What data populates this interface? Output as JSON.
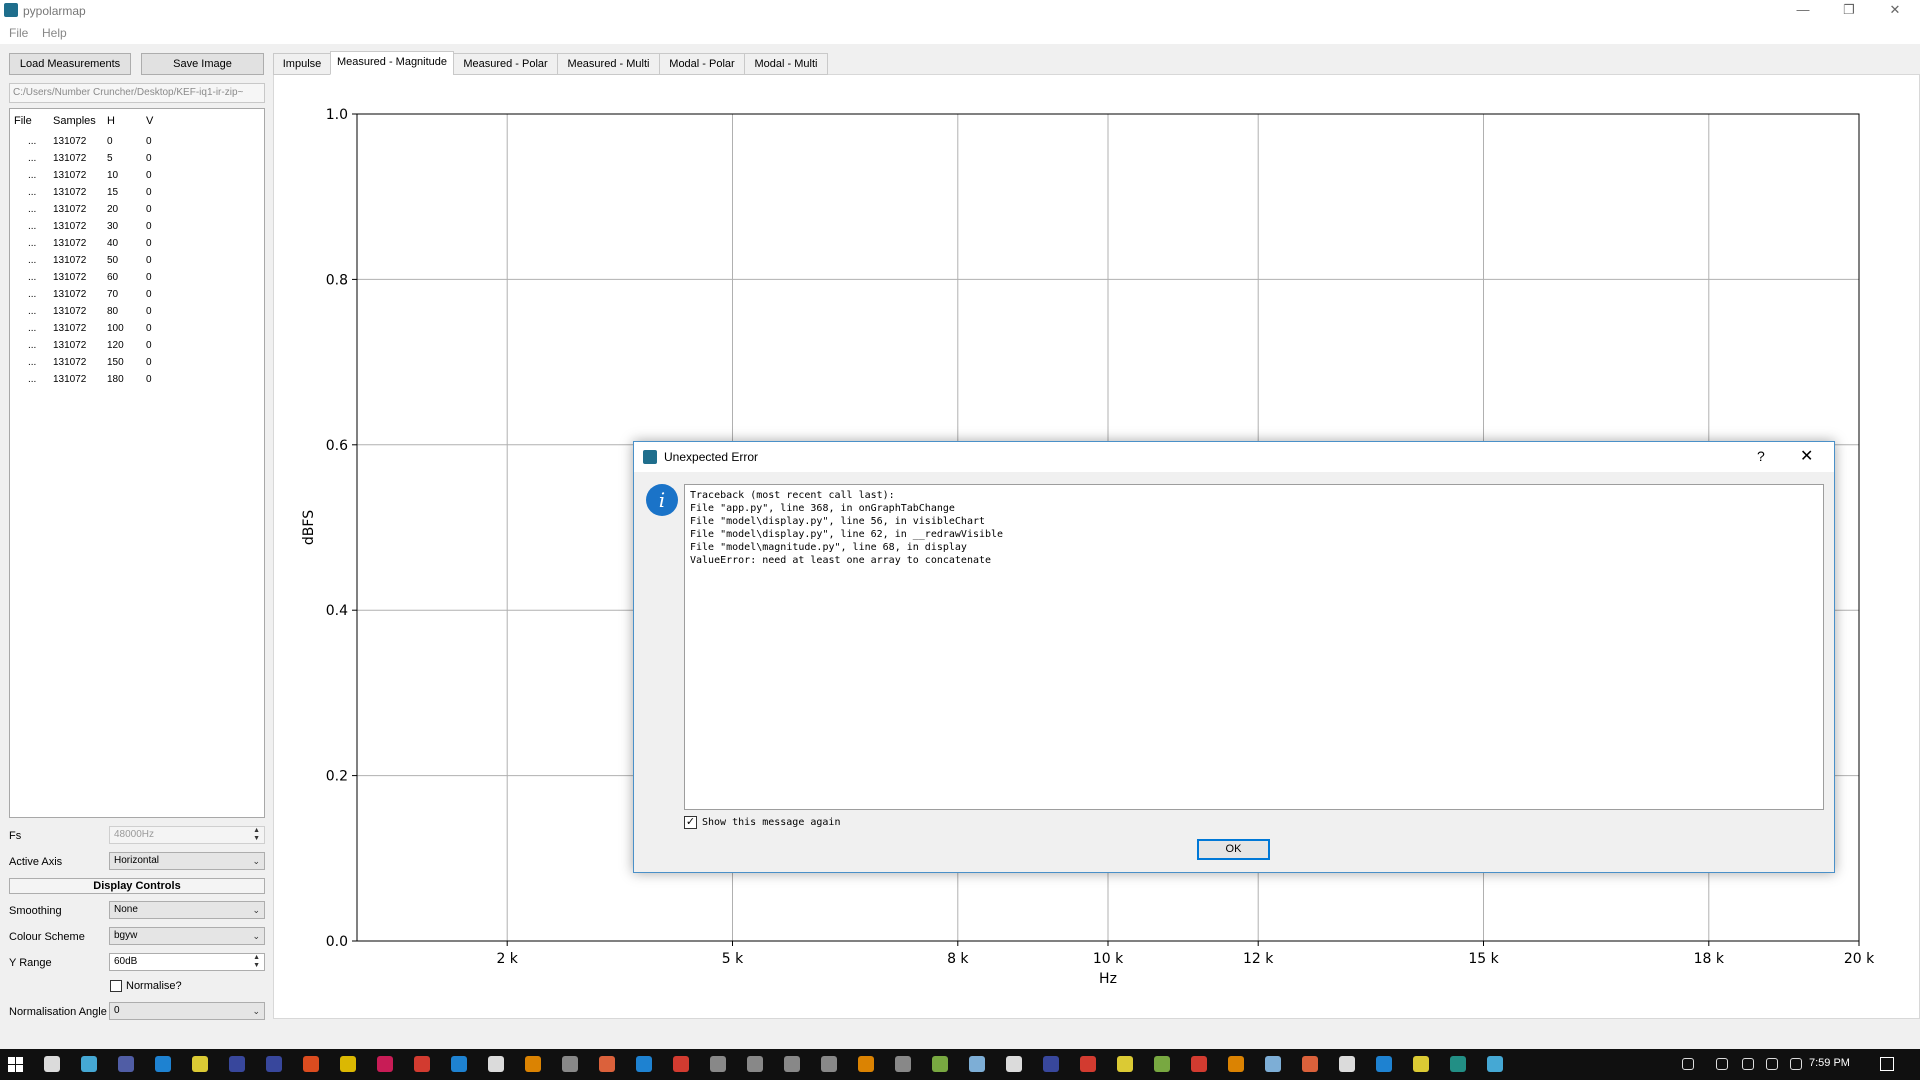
{
  "window": {
    "title": "pypolarmap",
    "min": "—",
    "restore": "❐",
    "close": "✕"
  },
  "menu": [
    "File",
    "Help"
  ],
  "toolbar": {
    "load_label": "Load Measurements",
    "save_label": "Save Image"
  },
  "path": "C:/Users/Number Cruncher/Desktop/KEF-iq1-ir-zip~",
  "table": {
    "headers": [
      "File",
      "Samples",
      "H",
      "V"
    ],
    "rows": [
      [
        "...",
        "131072",
        "0",
        "0"
      ],
      [
        "...",
        "131072",
        "5",
        "0"
      ],
      [
        "...",
        "131072",
        "10",
        "0"
      ],
      [
        "...",
        "131072",
        "15",
        "0"
      ],
      [
        "...",
        "131072",
        "20",
        "0"
      ],
      [
        "...",
        "131072",
        "30",
        "0"
      ],
      [
        "...",
        "131072",
        "40",
        "0"
      ],
      [
        "...",
        "131072",
        "50",
        "0"
      ],
      [
        "...",
        "131072",
        "60",
        "0"
      ],
      [
        "...",
        "131072",
        "70",
        "0"
      ],
      [
        "...",
        "131072",
        "80",
        "0"
      ],
      [
        "...",
        "131072",
        "100",
        "0"
      ],
      [
        "...",
        "131072",
        "120",
        "0"
      ],
      [
        "...",
        "131072",
        "150",
        "0"
      ],
      [
        "...",
        "131072",
        "180",
        "0"
      ]
    ]
  },
  "controls": {
    "fs_label": "Fs",
    "fs_value": "48000Hz",
    "axis_label": "Active Axis",
    "axis_value": "Horizontal",
    "display_header": "Display Controls",
    "smoothing_label": "Smoothing",
    "smoothing_value": "None",
    "colour_label": "Colour Scheme",
    "colour_value": "bgyw",
    "yrange_label": "Y Range",
    "yrange_value": "60dB",
    "normalise_label": "Normalise?",
    "normangle_label": "Normalisation Angle",
    "normangle_value": "0"
  },
  "tabs": [
    "Impulse",
    "Measured - Magnitude",
    "Measured - Polar",
    "Measured - Multi",
    "Modal - Polar",
    "Modal - Multi"
  ],
  "active_tab": "Measured - Magnitude",
  "chart_data": {
    "type": "line",
    "xlabel": "Hz",
    "ylabel": "dBFS",
    "xlim": [
      0,
      20000
    ],
    "ylim": [
      0.0,
      1.0
    ],
    "x_ticks": [
      {
        "value": 2000,
        "label": "2 k"
      },
      {
        "value": 5000,
        "label": "5 k"
      },
      {
        "value": 8000,
        "label": "8 k"
      },
      {
        "value": 10000,
        "label": "10 k"
      },
      {
        "value": 12000,
        "label": "12 k"
      },
      {
        "value": 15000,
        "label": "15 k"
      },
      {
        "value": 18000,
        "label": "18 k"
      },
      {
        "value": 20000,
        "label": "20 k"
      }
    ],
    "y_ticks": [
      "0.0",
      "0.2",
      "0.4",
      "0.6",
      "0.8",
      "1.0"
    ],
    "grid": true,
    "series": []
  },
  "dialog": {
    "title": "Unexpected Error",
    "help": "?",
    "close": "✕",
    "info_glyph": "i",
    "traceback": "Traceback (most recent call last):\nFile \"app.py\", line 368, in onGraphTabChange\nFile \"model\\display.py\", line 56, in visibleChart\nFile \"model\\display.py\", line 62, in __redrawVisible\nFile \"model\\magnitude.py\", line 68, in display\nValueError: need at least one array to concatenate",
    "show_again_label": "Show this message again",
    "show_again_checked": "✓",
    "ok_label": "OK"
  },
  "taskbar": {
    "time": "7:59 PM"
  }
}
